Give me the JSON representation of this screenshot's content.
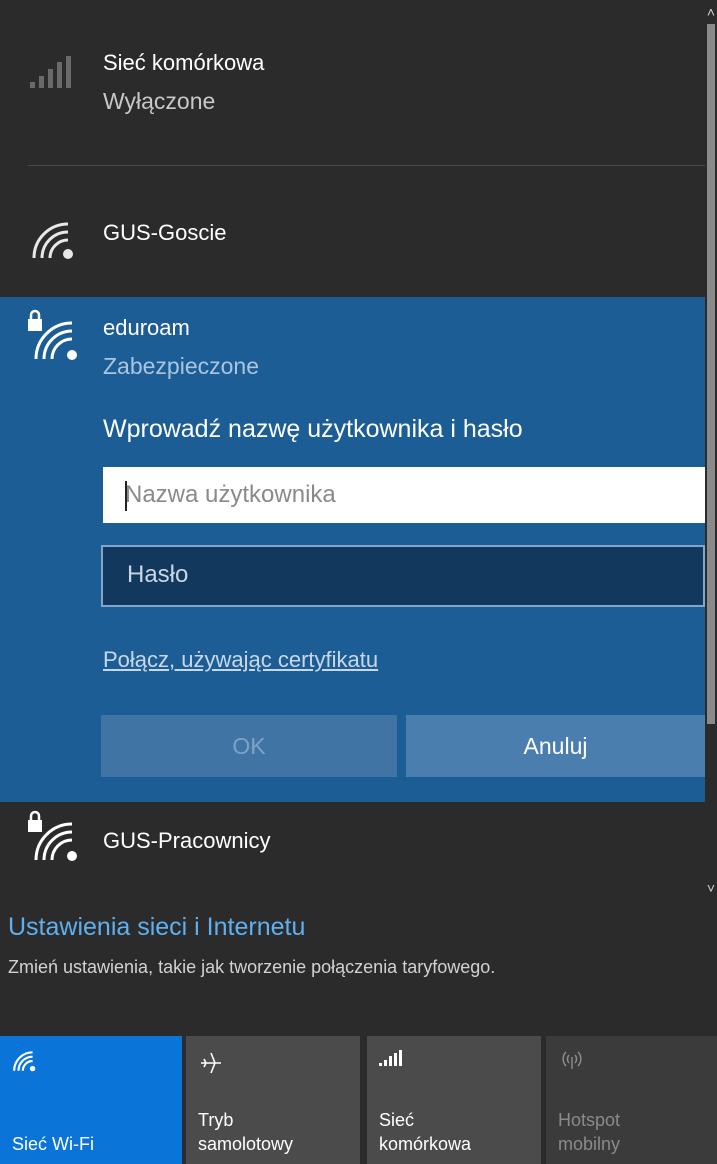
{
  "cellular": {
    "name": "Sieć komórkowa",
    "status": "Wyłączone"
  },
  "networks": [
    {
      "name": "GUS-Goscie"
    },
    {
      "name": "eduroam",
      "status": "Zabezpieczone"
    },
    {
      "name": "GUS-Pracownicy"
    }
  ],
  "login": {
    "prompt": "Wprowadź nazwę użytkownika i hasło",
    "username_placeholder": "Nazwa użytkownika",
    "password_placeholder": "Hasło",
    "cert_link": "Połącz, używając certyfikatu",
    "ok_label": "OK",
    "cancel_label": "Anuluj"
  },
  "settings": {
    "title": "Ustawienia sieci i Internetu",
    "subtitle": "Zmień ustawienia, takie jak tworzenie połączenia taryfowego."
  },
  "tiles": {
    "wifi": "Sieć Wi-Fi",
    "airplane_line1": "Tryb",
    "airplane_line2": "samolotowy",
    "cellular_line1": "Sieć",
    "cellular_line2": "komórkowa",
    "hotspot_line1": "Hotspot",
    "hotspot_line2": "mobilny"
  },
  "colors": {
    "panel_bg": "#2b2b2b",
    "selected_bg": "#1c5d96",
    "accent": "#0a74d8",
    "link": "#5fb0f0"
  },
  "icons": [
    "cellular-signal-icon",
    "wifi-icon",
    "wifi-secured-icon",
    "airplane-icon",
    "hotspot-icon"
  ]
}
